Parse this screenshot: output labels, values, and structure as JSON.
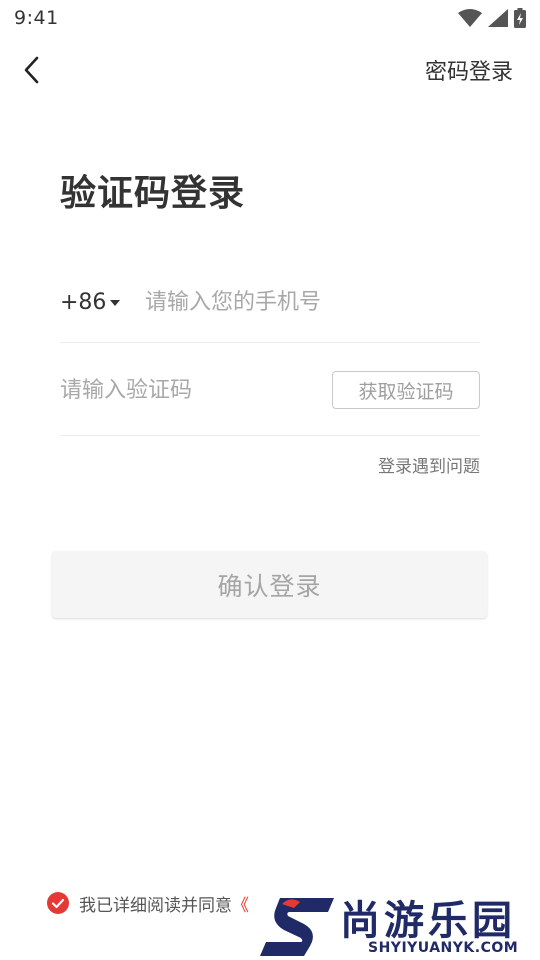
{
  "status_bar": {
    "time": "9:41",
    "icons": [
      "wifi-icon",
      "cell-signal-icon",
      "battery-charging-icon"
    ]
  },
  "nav": {
    "back_icon": "chevron-left-icon",
    "password_login_label": "密码登录"
  },
  "title": "验证码登录",
  "phone": {
    "country_code": "+86",
    "placeholder": "请输入您的手机号",
    "value": ""
  },
  "code": {
    "placeholder": "请输入验证码",
    "value": "",
    "get_code_label": "获取验证码"
  },
  "login_help_label": "登录遇到问题",
  "confirm_button_label": "确认登录",
  "agreement": {
    "checked": true,
    "text": "我已详细阅读并同意",
    "link_text": "《"
  },
  "watermark": {
    "name": "尚游乐园",
    "url": "SHYIYUANYK.COM"
  },
  "colors": {
    "accent_red": "#e53935",
    "watermark_navy": "#1f2a66",
    "disabled_text": "#a5a5a5"
  }
}
